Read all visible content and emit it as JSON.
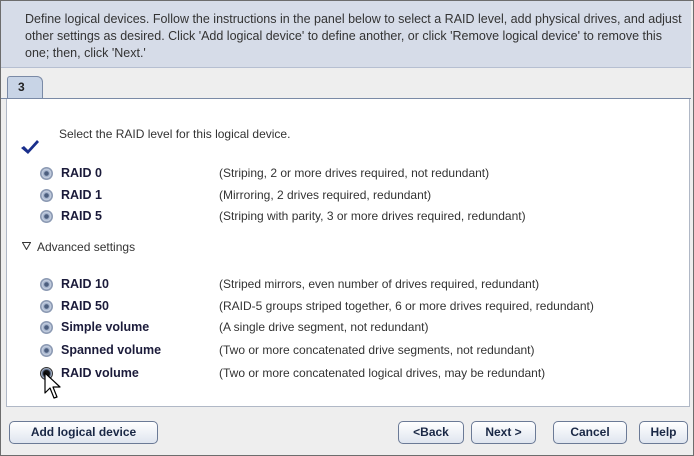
{
  "instructions": "Define logical devices.  Follow the instructions in the panel below to select a RAID level, add physical drives, and adjust other settings as desired.  Click 'Add logical device' to define another, or click 'Remove logical device' to remove this one; then, click 'Next.'",
  "tab_label": "3",
  "prompt": "Select the RAID level for this logical device.",
  "primary_options": [
    {
      "name": "RAID 0",
      "desc": "(Striping, 2 or more drives required, not redundant)"
    },
    {
      "name": "RAID 1",
      "desc": "(Mirroring, 2 drives required, redundant)"
    },
    {
      "name": "RAID 5",
      "desc": "(Striping with parity, 3 or more drives required, redundant)"
    }
  ],
  "advanced_label": "Advanced settings",
  "advanced_options": [
    {
      "name": "RAID 10",
      "desc": "(Striped mirrors, even number of drives required, redundant)"
    },
    {
      "name": "RAID 50",
      "desc": "(RAID-5 groups striped together, 6 or more drives required, redundant)"
    },
    {
      "name": "Simple volume",
      "desc": "(A single drive segment, not redundant)"
    },
    {
      "name": "Spanned volume",
      "desc": "(Two or more concatenated drive segments, not redundant)"
    },
    {
      "name": "RAID volume",
      "desc": "(Two or more concatenated logical drives, may be redundant)"
    }
  ],
  "selected_option": "RAID volume",
  "buttons": {
    "add": "Add logical device",
    "back": "<Back",
    "next": "Next >",
    "cancel": "Cancel",
    "help": "Help"
  },
  "colors": {
    "instructions_bg": "#d6dce8",
    "check_color": "#1a2f8c",
    "label_color": "#1b1b3a"
  }
}
